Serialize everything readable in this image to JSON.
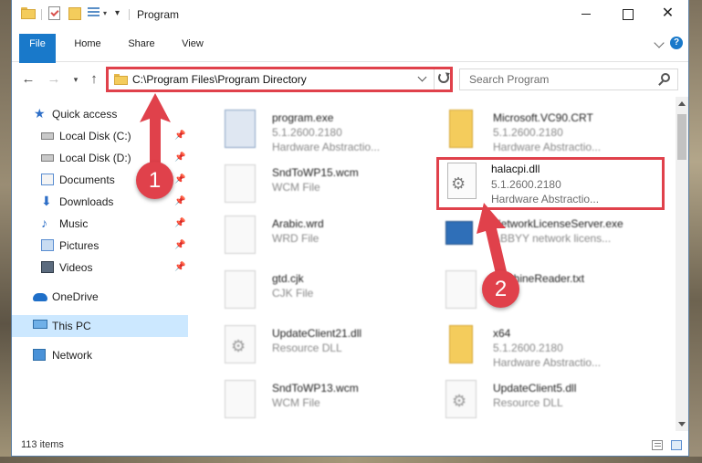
{
  "window": {
    "title": "Program",
    "controls": {
      "minimize": "",
      "maximize": "",
      "close": "✕"
    }
  },
  "ribbon": {
    "tabs": [
      "File",
      "Home",
      "Share",
      "View"
    ],
    "help": "?"
  },
  "address": {
    "path": "C:\\Program Files\\Program Directory"
  },
  "search": {
    "placeholder": "Search Program"
  },
  "nav": {
    "items": [
      {
        "label": "Quick access",
        "icon": "star-icon"
      },
      {
        "label": "Local Disk (C:)",
        "icon": "disk-icon",
        "pinned": true
      },
      {
        "label": "Local Disk (D:)",
        "icon": "disk-icon",
        "pinned": true
      },
      {
        "label": "Documents",
        "icon": "documents-icon",
        "pinned": true
      },
      {
        "label": "Downloads",
        "icon": "downloads-icon",
        "pinned": true
      },
      {
        "label": "Music",
        "icon": "music-icon",
        "pinned": true
      },
      {
        "label": "Pictures",
        "icon": "pictures-icon",
        "pinned": true
      },
      {
        "label": "Videos",
        "icon": "videos-icon",
        "pinned": true
      },
      {
        "label": "OneDrive",
        "icon": "onedrive-icon"
      },
      {
        "label": "This PC",
        "icon": "this-pc-icon",
        "selected": true
      },
      {
        "label": "Network",
        "icon": "network-icon"
      }
    ]
  },
  "files": {
    "left": [
      {
        "name": "program.exe",
        "line1": "5.1.2600.2180",
        "line2": "Hardware Abstractio..."
      },
      {
        "name": "SndToWP15.wcm",
        "line1": "WCM File",
        "line2": ""
      },
      {
        "name": "Arabic.wrd",
        "line1": "WRD File",
        "line2": ""
      },
      {
        "name": "gtd.cjk",
        "line1": "CJK File",
        "line2": ""
      },
      {
        "name": "UpdateClient21.dll",
        "line1": "Resource DLL",
        "line2": ""
      },
      {
        "name": "SndToWP13.wcm",
        "line1": "WCM File",
        "line2": ""
      }
    ],
    "right": [
      {
        "name": "Microsoft.VC90.CRT",
        "line1": "5.1.2600.2180",
        "line2": "Hardware Abstractio..."
      },
      {
        "name": "NetworkLicenseServer.exe",
        "line1": "ABBYY network licens...",
        "line2": ""
      },
      {
        "name": "MachineReader.txt",
        "line1": "",
        "line2": ""
      },
      {
        "name": "x64",
        "line1": "5.1.2600.2180",
        "line2": "Hardware Abstractio..."
      },
      {
        "name": "UpdateClient5.dll",
        "line1": "Resource DLL",
        "line2": ""
      }
    ],
    "highlighted": {
      "name": "halacpi.dll",
      "line1": "5.1.2600.2180",
      "line2": "Hardware Abstractio..."
    }
  },
  "status": {
    "count": "113 items"
  },
  "callouts": {
    "one": "1",
    "two": "2"
  },
  "colors": {
    "accent": "#1979ca",
    "highlight": "#e0414b",
    "selected": "#cce8ff"
  }
}
